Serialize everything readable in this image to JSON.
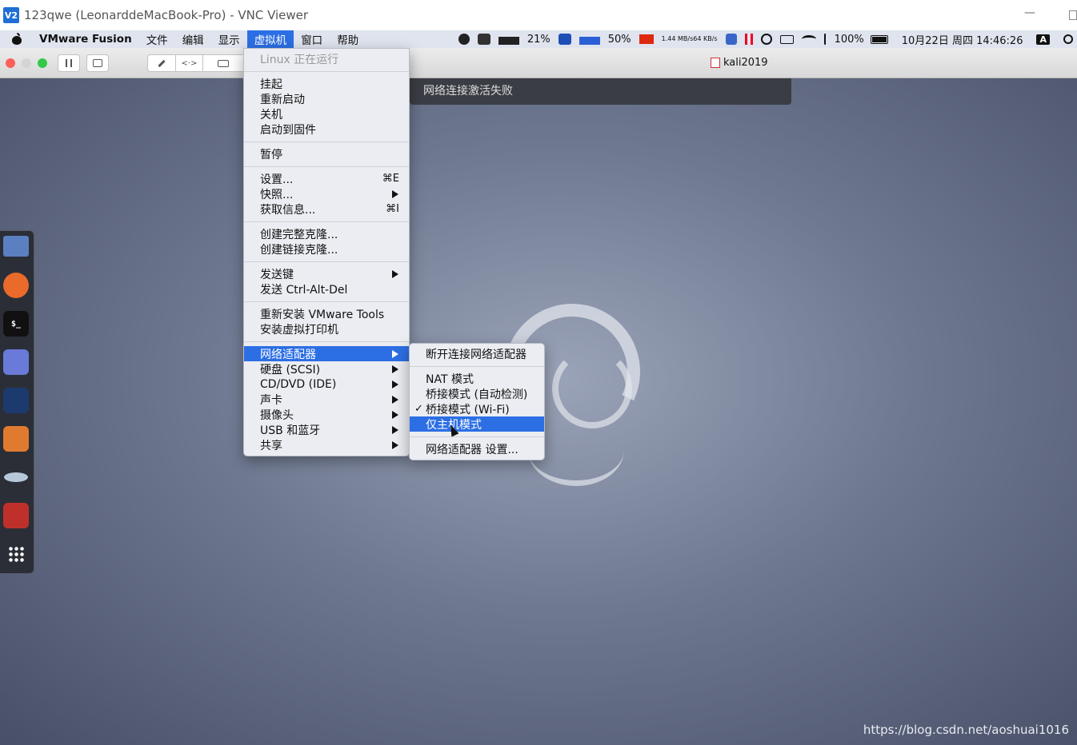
{
  "vnc": {
    "logo": "V2",
    "title": "123qwe (LeonarddeMacBook-Pro) - VNC Viewer",
    "minimize": "—"
  },
  "menubar": {
    "app": "VMware Fusion",
    "items": [
      "文件",
      "编辑",
      "显示",
      "虚拟机",
      "窗口",
      "帮助"
    ],
    "active": "虚拟机",
    "status": {
      "cpu": "21%",
      "mem": "50%",
      "net_up": "1.44 MB/s",
      "net_down": "64 KB/s",
      "battery": "100%",
      "datetime": "10月22日 周四  14:46:26",
      "input": "A"
    }
  },
  "toolbar": {
    "vm_name": "kali2019"
  },
  "notification": "网络连接激活失败",
  "main_menu": {
    "header": "Linux 正在运行",
    "items": [
      {
        "label": "挂起"
      },
      {
        "label": "重新启动"
      },
      {
        "label": "关机"
      },
      {
        "label": "启动到固件"
      },
      {
        "label": "暂停"
      },
      {
        "label": "设置...",
        "shortcut": "⌘E"
      },
      {
        "label": "快照..."
      },
      {
        "label": "获取信息...",
        "shortcut": "⌘I"
      },
      {
        "label": "创建完整克隆..."
      },
      {
        "label": "创建链接克隆..."
      },
      {
        "label": "发送键"
      },
      {
        "label": "发送 Ctrl-Alt-Del"
      },
      {
        "label": "重新安装 VMware Tools"
      },
      {
        "label": "安装虚拟打印机"
      },
      {
        "label": "网络适配器"
      },
      {
        "label": "硬盘 (SCSI)"
      },
      {
        "label": "CD/DVD (IDE)"
      },
      {
        "label": "声卡"
      },
      {
        "label": "摄像头"
      },
      {
        "label": "USB 和蓝牙"
      },
      {
        "label": "共享"
      }
    ]
  },
  "sub_menu": {
    "items": [
      {
        "label": "断开连接网络适配器"
      },
      {
        "label": "NAT 模式"
      },
      {
        "label": "桥接模式 (自动检测)"
      },
      {
        "label": "桥接模式 (Wi-Fi)",
        "check": "✓"
      },
      {
        "label": "仅主机模式"
      },
      {
        "label": "网络适配器 设置..."
      }
    ]
  },
  "dock": {
    "terminal_label": "$_"
  },
  "watermark": "https://blog.csdn.net/aoshuai1016",
  "colors": {
    "highlight": "#2c6fe4",
    "menubar": "#dfe4ee"
  }
}
